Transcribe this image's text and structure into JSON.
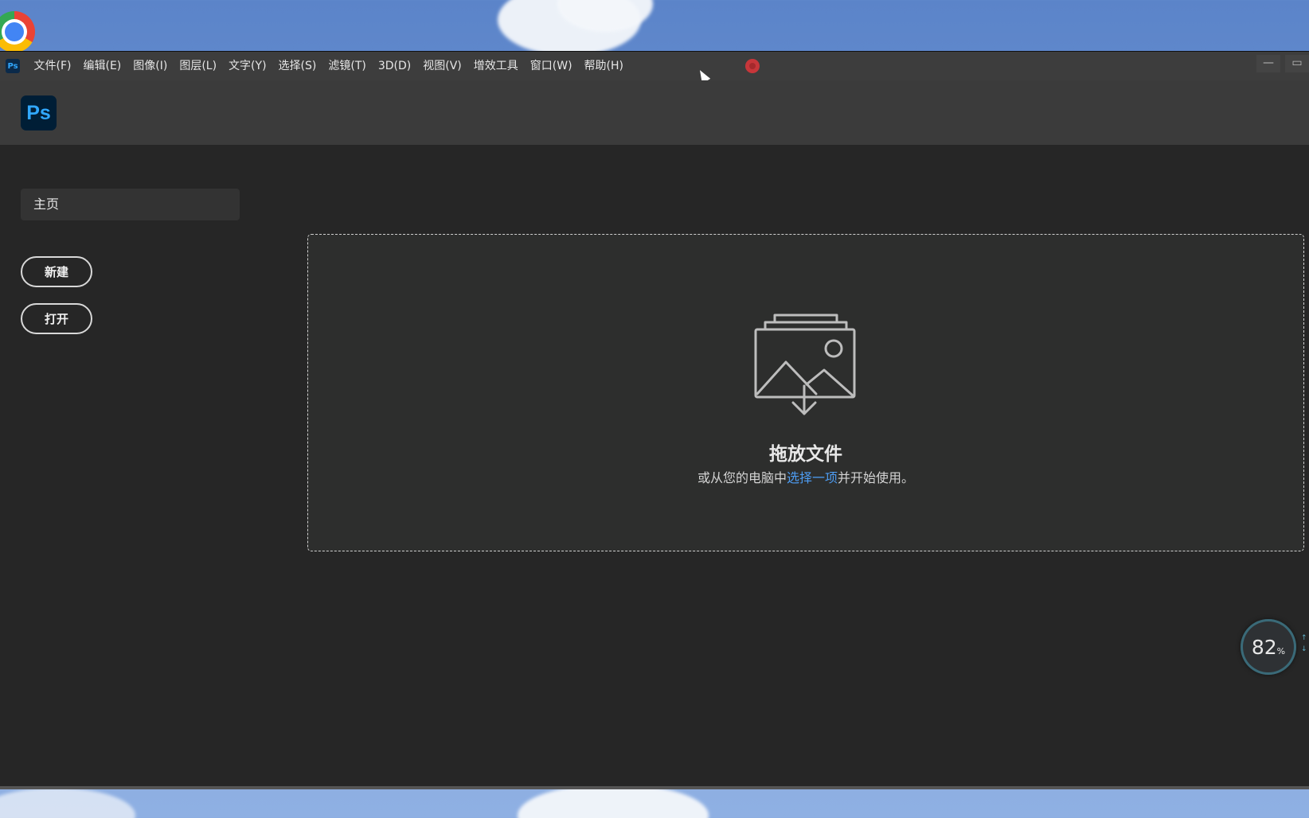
{
  "menubar": {
    "app_icon": "Ps",
    "items": [
      "文件(F)",
      "编辑(E)",
      "图像(I)",
      "图层(L)",
      "文字(Y)",
      "选择(S)",
      "滤镜(T)",
      "3D(D)",
      "视图(V)",
      "增效工具",
      "窗口(W)",
      "帮助(H)"
    ],
    "minimize_label": "—",
    "restore_label": "▭"
  },
  "header": {
    "logo_text": "Ps"
  },
  "sidebar": {
    "home_label": "主页",
    "new_button": "新建",
    "open_button": "打开"
  },
  "dropzone": {
    "title": "拖放文件",
    "sub_before": "或从您的电脑中",
    "sub_link": "选择一项",
    "sub_after": "并开始使用。",
    "icon": "image-download-icon"
  },
  "perf": {
    "value": "82",
    "unit": "%"
  },
  "colors": {
    "accent_blue": "#31a8ff",
    "link_blue": "#4d9cf2",
    "window_bg": "#262626",
    "dropzone_bg": "#2d2e2d"
  }
}
